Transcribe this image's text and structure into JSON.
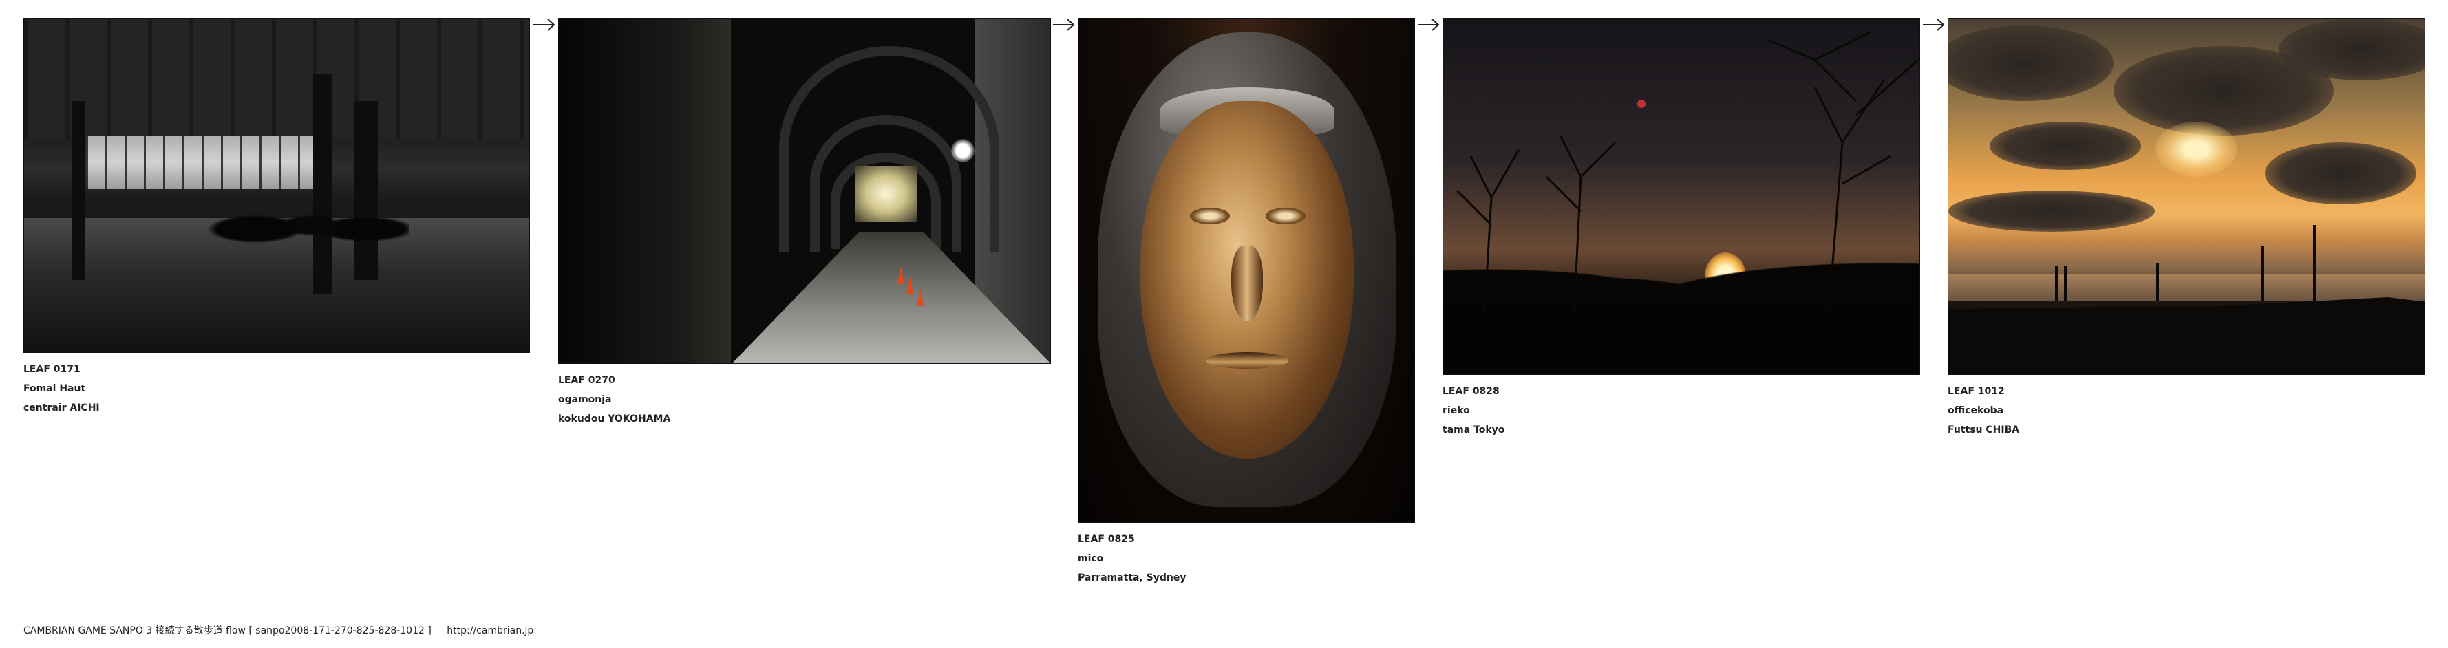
{
  "flow": {
    "leaves": [
      {
        "code": "LEAF 0171",
        "author": "Fomal Haut",
        "location": "centrair AICHI",
        "photo_subject": "airport-terminal-photo"
      },
      {
        "code": "LEAF 0270",
        "author": "ogamonja",
        "location": "kokudou YOKOHAMA",
        "photo_subject": "arcade-tunnel-photo"
      },
      {
        "code": "LEAF 0825",
        "author": "mico",
        "location": "Parramatta, Sydney",
        "photo_subject": "bronze-face-photo"
      },
      {
        "code": "LEAF 0828",
        "author": "rieko",
        "location": "tama Tokyo",
        "photo_subject": "sunset-trees-photo"
      },
      {
        "code": "LEAF 1012",
        "author": "officekoba",
        "location": "Futtsu CHIBA",
        "photo_subject": "coastal-sunset-photo"
      }
    ],
    "arrow_icon": "arrow-right-icon"
  },
  "footer": {
    "title": "CAMBRIAN GAME  SANPO 3 接続する散歩道 flow [ sanpo2008-171-270-825-828-1012 ]",
    "link": "http://cambrian.jp"
  }
}
